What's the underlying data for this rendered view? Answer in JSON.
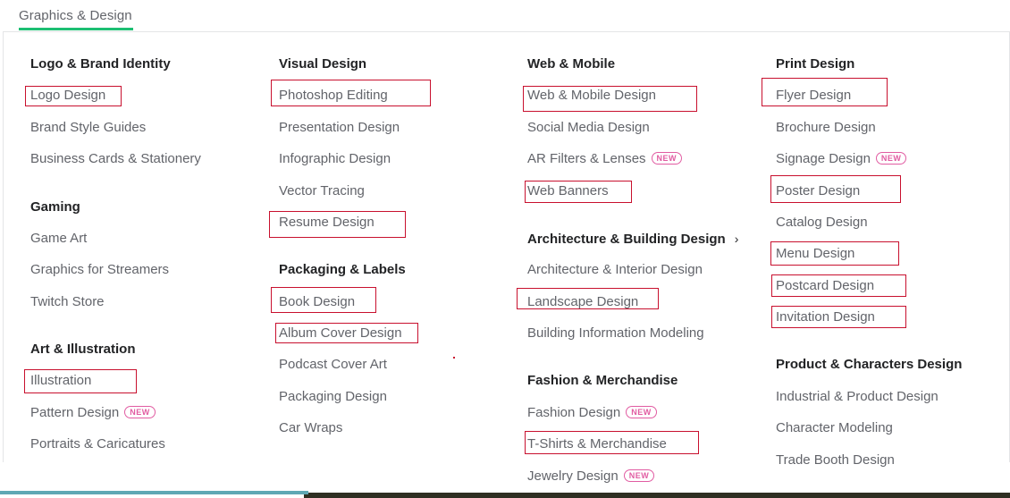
{
  "nav": {
    "tab_label": "Graphics & Design",
    "accent_color": "#1dbf73"
  },
  "badge_label": "NEW",
  "badge_color": "#e15ca2",
  "highlight_color": "#c8102e",
  "columns": [
    {
      "groups": [
        {
          "heading": "Logo & Brand Identity",
          "items": [
            "Logo Design",
            "Brand Style Guides",
            "Business Cards & Stationery"
          ]
        },
        {
          "heading": "Gaming",
          "items": [
            "Game Art",
            "Graphics for Streamers",
            "Twitch Store"
          ]
        },
        {
          "heading": "Art & Illustration",
          "items": [
            "Illustration",
            "Pattern Design",
            "Portraits & Caricatures"
          ]
        }
      ]
    },
    {
      "groups": [
        {
          "heading": "Visual Design",
          "items": [
            "Photoshop Editing",
            "Presentation Design",
            "Infographic Design",
            "Vector Tracing",
            "Resume Design"
          ]
        },
        {
          "heading": "Packaging & Labels",
          "items": [
            "Book Design",
            "Album Cover Design",
            "Podcast Cover Art",
            "Packaging Design",
            "Car Wraps"
          ]
        }
      ]
    },
    {
      "groups": [
        {
          "heading": "Web & Mobile",
          "items": [
            "Web & Mobile Design",
            "Social Media Design",
            "AR Filters & Lenses",
            "Web Banners"
          ]
        },
        {
          "heading": "Architecture & Building Design",
          "heading_icon": "chevron-right-icon",
          "items": [
            "Architecture & Interior Design",
            "Landscape Design",
            "Building Information Modeling"
          ]
        },
        {
          "heading": "Fashion & Merchandise",
          "items": [
            "Fashion Design",
            "T-Shirts & Merchandise",
            "Jewelry Design"
          ]
        }
      ]
    },
    {
      "groups": [
        {
          "heading": "Print Design",
          "items": [
            "Flyer Design",
            "Brochure Design",
            "Signage Design",
            "Poster Design",
            "Catalog Design",
            "Menu Design",
            "Postcard Design",
            "Invitation Design"
          ]
        },
        {
          "heading": "Product & Characters Design",
          "items": [
            "Industrial & Product Design",
            "Character Modeling",
            "Trade Booth Design"
          ]
        }
      ]
    }
  ]
}
